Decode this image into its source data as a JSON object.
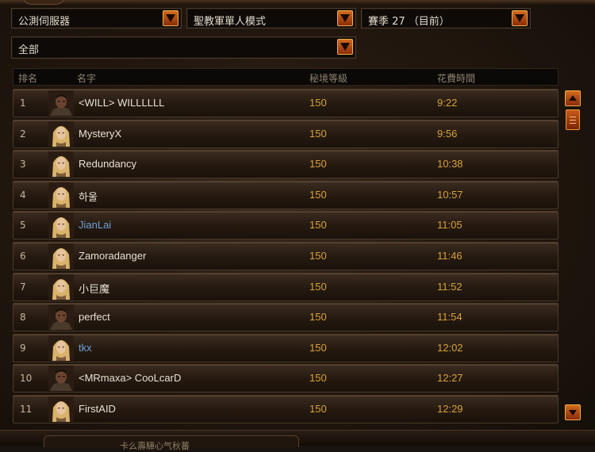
{
  "filters": {
    "server": "公測伺服器",
    "mode": "聖教軍單人模式",
    "season": "賽季 27 （目前）",
    "class": "全部"
  },
  "columns": {
    "rank": "排名",
    "name": "名字",
    "level": "秘境等級",
    "time": "花費時間"
  },
  "rows": [
    {
      "rank": "1",
      "name": "<WILL> WILLLLLL",
      "level": "150",
      "time": "9:22",
      "avatar": "male-dark"
    },
    {
      "rank": "2",
      "name": "MysteryX",
      "level": "150",
      "time": "9:56",
      "avatar": "female-blonde"
    },
    {
      "rank": "3",
      "name": "Redundancy",
      "level": "150",
      "time": "10:38",
      "avatar": "female-blonde"
    },
    {
      "rank": "4",
      "name": "하울",
      "level": "150",
      "time": "10:57",
      "avatar": "female-blonde"
    },
    {
      "rank": "5",
      "name": "JianLai",
      "level": "150",
      "time": "11:05",
      "avatar": "female-blonde",
      "link": true
    },
    {
      "rank": "6",
      "name": "Zamoradanger",
      "level": "150",
      "time": "11:46",
      "avatar": "female-blonde"
    },
    {
      "rank": "7",
      "name": "小巨魔",
      "level": "150",
      "time": "11:52",
      "avatar": "female-blonde"
    },
    {
      "rank": "8",
      "name": "perfect",
      "level": "150",
      "time": "11:54",
      "avatar": "male-dark"
    },
    {
      "rank": "9",
      "name": "tkx",
      "level": "150",
      "time": "12:02",
      "avatar": "female-blonde",
      "link": true
    },
    {
      "rank": "10",
      "name": "<MRmaxa> CooLcarD",
      "level": "150",
      "time": "12:27",
      "avatar": "male-dark"
    },
    {
      "rank": "11",
      "name": "FirstAID",
      "level": "150",
      "time": "12:29",
      "avatar": "female-blonde"
    }
  ],
  "bottom_tab": "卡么壽驊心气秋蕃",
  "colors": {
    "accent": "#d36a1d",
    "value": "#d8a23c",
    "link": "#6fa0d8",
    "text": "#e8e0d2"
  }
}
